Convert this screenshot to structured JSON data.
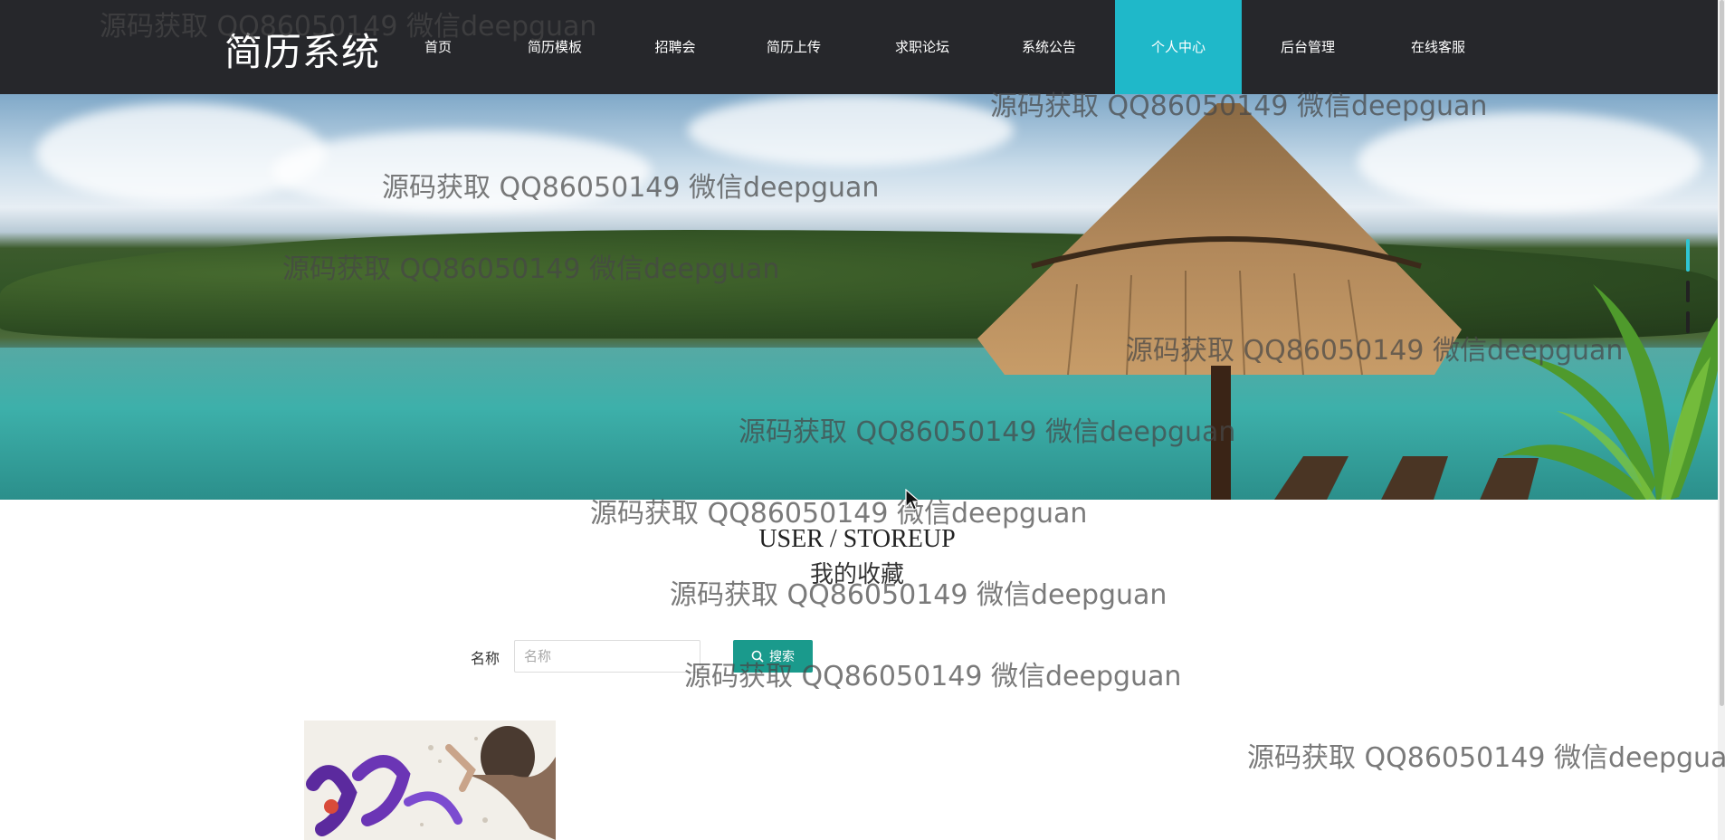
{
  "header": {
    "brand": "简历系统",
    "nav": [
      {
        "label": "首页"
      },
      {
        "label": "简历模板"
      },
      {
        "label": "招聘会"
      },
      {
        "label": "简历上传"
      },
      {
        "label": "求职论坛"
      },
      {
        "label": "系统公告"
      },
      {
        "label": "个人中心",
        "active": true
      },
      {
        "label": "后台管理"
      },
      {
        "label": "在线客服"
      }
    ],
    "active_color": "#1fb8c9",
    "background": "#26272b"
  },
  "page": {
    "title_en": "USER / STOREUP",
    "title_cn": "我的收藏"
  },
  "search": {
    "label": "名称",
    "placeholder": "名称",
    "value": "",
    "button_label": "搜索",
    "button_color": "#1a9a8c"
  },
  "watermark": {
    "text": "源码获取 QQ86050149 微信deepguan"
  }
}
